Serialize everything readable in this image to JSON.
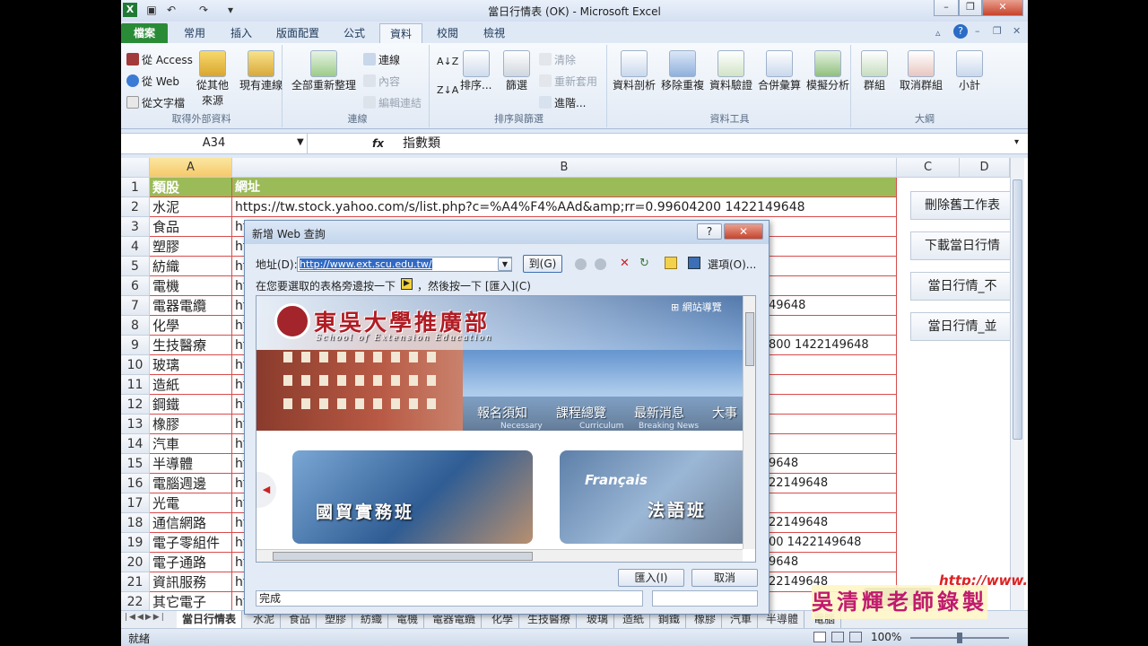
{
  "window": {
    "title": "當日行情表 (OK) - Microsoft Excel",
    "controls": [
      "–",
      "❐",
      "✕"
    ]
  },
  "ribbon_tabs": [
    "檔案",
    "常用",
    "插入",
    "版面配置",
    "公式",
    "資料",
    "校閱",
    "檢視"
  ],
  "active_tab": "資料",
  "ribbon": {
    "external": {
      "from_access": "從 Access",
      "from_web": "從 Web",
      "from_text": "從文字檔",
      "from_other": "從其他",
      "from_other2": "來源",
      "existing": "現有連線",
      "label": "取得外部資料"
    },
    "connections": {
      "refresh_all": "全部重新整理",
      "conn": "連線",
      "props": "內容",
      "edit_links": "編輯連結",
      "label": "連線"
    },
    "sort": {
      "sort": "排序...",
      "filter": "篩選",
      "clear": "清除",
      "reapply": "重新套用",
      "advanced": "進階...",
      "label": "排序與篩選"
    },
    "tools": {
      "text_to_cols": "資料剖析",
      "remove_dup": "移除重複",
      "validation": "資料驗證",
      "consolidate": "合併彙算",
      "whatif": "模擬分析",
      "label": "資料工具"
    },
    "outline": {
      "group": "群組",
      "ungroup": "取消群組",
      "subtotal": "小計",
      "label": "大綱"
    }
  },
  "formula_bar": {
    "name_box": "A34",
    "fx": "fx",
    "content": "指數類"
  },
  "columns": [
    "A",
    "B",
    "C",
    "D"
  ],
  "rows": [
    {
      "n": "1",
      "a": "類股",
      "b": "網址",
      "tail": ""
    },
    {
      "n": "2",
      "a": "水泥",
      "b": "https://tw.stock.yahoo.com/s/list.php?c=%A4%F4%AAd&amp;rr=0.99604200 1422149648",
      "tail": ""
    },
    {
      "n": "3",
      "a": "食品",
      "b": "ht",
      "tail": ""
    },
    {
      "n": "4",
      "a": "塑膠",
      "b": "ht",
      "tail": ""
    },
    {
      "n": "5",
      "a": "紡織",
      "b": "ht",
      "tail": ""
    },
    {
      "n": "6",
      "a": "電機",
      "b": "ht",
      "tail": ""
    },
    {
      "n": "7",
      "a": "電器電纜",
      "b": "ht",
      "tail": "49648"
    },
    {
      "n": "8",
      "a": "化學",
      "b": "ht",
      "tail": ""
    },
    {
      "n": "9",
      "a": "生技醫療",
      "b": "ht",
      "tail": "800 1422149648"
    },
    {
      "n": "10",
      "a": "玻璃",
      "b": "ht",
      "tail": ""
    },
    {
      "n": "11",
      "a": "造紙",
      "b": "ht",
      "tail": ""
    },
    {
      "n": "12",
      "a": "鋼鐵",
      "b": "ht",
      "tail": ""
    },
    {
      "n": "13",
      "a": "橡膠",
      "b": "ht",
      "tail": ""
    },
    {
      "n": "14",
      "a": "汽車",
      "b": "ht",
      "tail": ""
    },
    {
      "n": "15",
      "a": "半導體",
      "b": "ht",
      "tail": "9648"
    },
    {
      "n": "16",
      "a": "電腦週邊",
      "b": "ht",
      "tail": "22149648"
    },
    {
      "n": "17",
      "a": "光電",
      "b": "ht",
      "tail": ""
    },
    {
      "n": "18",
      "a": "通信網路",
      "b": "ht",
      "tail": "22149648"
    },
    {
      "n": "19",
      "a": "電子零組件",
      "b": "ht",
      "tail": "00 1422149648"
    },
    {
      "n": "20",
      "a": "電子通路",
      "b": "ht",
      "tail": "9648"
    },
    {
      "n": "21",
      "a": "資訊服務",
      "b": "ht",
      "tail": "22149648"
    },
    {
      "n": "22",
      "a": "其它電子",
      "b": "ht",
      "tail": ""
    }
  ],
  "side_buttons": [
    "刪除舊工作表",
    "下載當日行情",
    "當日行情_不",
    "當日行情_並"
  ],
  "sheet_tabs": [
    "當日行情表",
    "水泥",
    "食品",
    "塑膠",
    "紡織",
    "電機",
    "電器電纜",
    "化學",
    "生技醫療",
    "玻璃",
    "造紙",
    "鋼鐵",
    "橡膠",
    "汽車",
    "半導體",
    "電腦"
  ],
  "status": {
    "ready": "就緒",
    "zoom": "100%"
  },
  "dialog": {
    "title": "新增 Web 查詢",
    "address_label": "地址(D):",
    "address_value": "http://www.ext.scu.edu.tw/",
    "go_button": "到(G)",
    "options_label": "選項(O)...",
    "instruction_a": "在您要選取的表格旁邊按一下",
    "instruction_b": "，然後按一下 [匯入](C)",
    "status": "完成",
    "import_button": "匯入(I)",
    "cancel_button": "取消",
    "help": "?",
    "close": "✕"
  },
  "webpage": {
    "school": "東吳大學推廣部",
    "school_en": "School of Extension Education",
    "sitemap": "網站導覽",
    "nav": [
      {
        "zh": "報名須知",
        "en": "Necessary"
      },
      {
        "zh": "課程總覽",
        "en": "Curriculum"
      },
      {
        "zh": "最新消息",
        "en": "Breaking News"
      },
      {
        "zh": "大事",
        "en": ""
      }
    ],
    "card1": "國貿實務班",
    "card2_en": "Français",
    "card2": "法語班"
  },
  "watermark": {
    "url": "http://www.tqc.idv.tw/",
    "text": "吳清輝老師錄製"
  }
}
